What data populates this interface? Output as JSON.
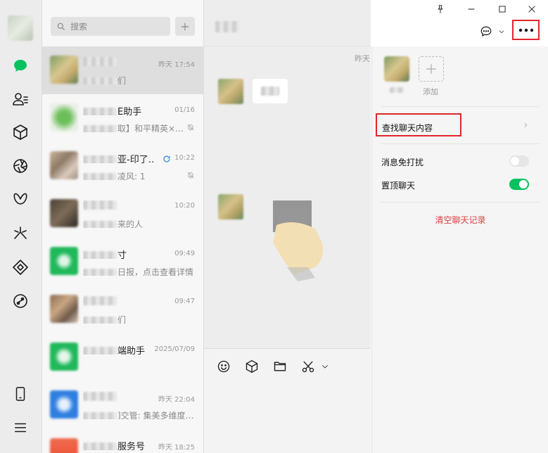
{
  "search": {
    "placeholder": "搜索"
  },
  "chats": [
    {
      "name_suffix": "",
      "time": "昨天 17:54",
      "preview_suffix": "们",
      "selected": true
    },
    {
      "name_suffix": "E助手",
      "time": "01/16",
      "preview_suffix": "取】和平精英×…",
      "muted": true
    },
    {
      "name_suffix": "亚-印了…",
      "time": "10:22",
      "preview_suffix": "凌风: 1",
      "muted": true
    },
    {
      "name_suffix": "",
      "time": "10:20",
      "preview_suffix": "来的人"
    },
    {
      "name_suffix": "寸",
      "time": "09:49",
      "preview_suffix": "日报，点击查看详情"
    },
    {
      "name_suffix": "",
      "time": "09:47",
      "preview_suffix": "们"
    },
    {
      "name_suffix": "端助手",
      "time": "2025/07/09",
      "preview_suffix": ""
    },
    {
      "name_suffix": "",
      "time": "昨天 22:04",
      "preview_suffix": "]交管: 集美多维度…"
    },
    {
      "name_suffix": "服务号",
      "time": "昨天 18:25",
      "preview_suffix": ""
    }
  ],
  "chat": {
    "message_time": "昨天"
  },
  "panel": {
    "add_label": "添加",
    "search_history": "查找聊天内容",
    "mute_label": "消息免打扰",
    "mute_on": false,
    "pin_label": "置顶聊天",
    "pin_on": true,
    "clear_label": "清空聊天记录"
  },
  "colors": {
    "accent": "#07c160",
    "highlight": "#e0262b",
    "danger": "#e04040"
  },
  "icons": {
    "rail": [
      "chat-icon",
      "contacts-icon",
      "cube-icon",
      "aperture-icon",
      "butterfly-icon",
      "sparkle-icon",
      "diamond-icon",
      "mini-program-icon",
      "phone-icon",
      "menu-icon"
    ],
    "toolbar": [
      "emoji-icon",
      "cube-icon",
      "folder-icon",
      "scissors-icon"
    ]
  }
}
